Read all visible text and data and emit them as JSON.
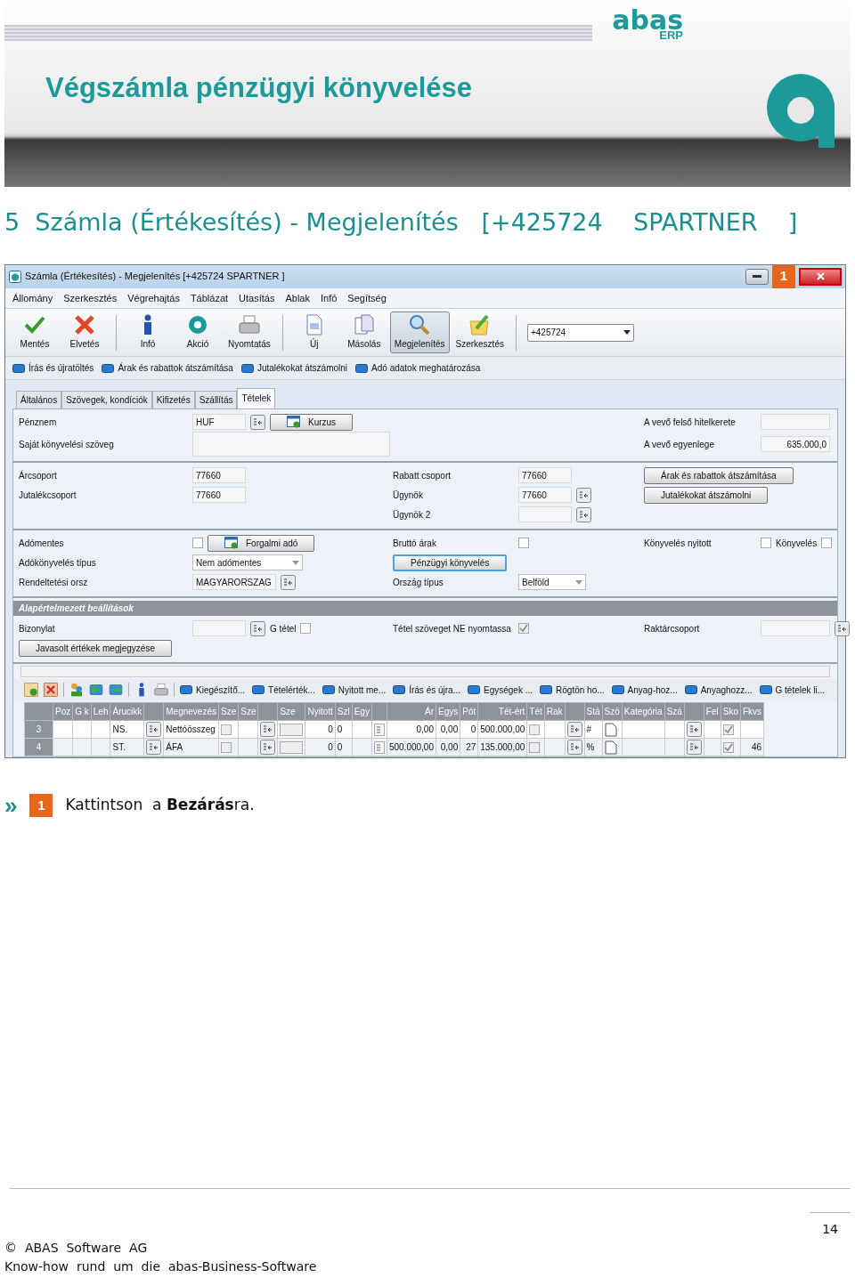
{
  "banner": {
    "logo": "abas",
    "logo_sub": "ERP",
    "title": "Végszámla pénzügyi könyvelése"
  },
  "heading": "5  Számla (Értékesítés) - Megjelenítés   [+425724    SPARTNER    ]",
  "window": {
    "title": "Számla (Értékesítés) - Megjelenítés  [+425724   SPARTNER   ]",
    "callout": "1",
    "menu": [
      "Állomány",
      "Szerkesztés",
      "Végrehajtás",
      "Táblázat",
      "Utasítás",
      "Ablak",
      "Infó",
      "Segítség"
    ],
    "toolbar": [
      {
        "kind": "save",
        "label": "Mentés",
        "selected": false
      },
      {
        "kind": "discard",
        "label": "Elvetés",
        "selected": false
      },
      {
        "kind": "sep"
      },
      {
        "kind": "info",
        "label": "Infó",
        "selected": false
      },
      {
        "kind": "action",
        "label": "Akció",
        "selected": false
      },
      {
        "kind": "print",
        "label": "Nyomtatás",
        "selected": false
      },
      {
        "kind": "sep"
      },
      {
        "kind": "new",
        "label": "Új",
        "selected": false
      },
      {
        "kind": "copy",
        "label": "Másolás",
        "selected": false
      },
      {
        "kind": "view",
        "label": "Megjelenítés",
        "selected": true
      },
      {
        "kind": "edit",
        "label": "Szerkesztés",
        "selected": false
      },
      {
        "kind": "sep"
      }
    ],
    "record_combo": {
      "value": "+425724"
    },
    "actions": [
      "Írás és újratöltés",
      "Árak és rabattok átszámítása",
      "Jutalékokat átszámolni",
      "Adó adatok meghatározása"
    ],
    "tabs": [
      {
        "label": "Általános",
        "selected": false
      },
      {
        "label": "Szövegek, kondíciók",
        "selected": false
      },
      {
        "label": "Kifizetés",
        "selected": false
      },
      {
        "label": "Szállítás",
        "selected": false
      },
      {
        "label": "Tételek",
        "selected": true
      }
    ],
    "sections": [
      {
        "rows": [
          {
            "cells": [
              [
                {
                  "kind": "label",
                  "text": "Pénznem"
                },
                {
                  "kind": "field",
                  "value": "HUF",
                  "lookup": true
                },
                {
                  "kind": "button",
                  "label": "Kurzus",
                  "icon": true
                }
              ],
              [],
              [
                {
                  "kind": "label",
                  "text": "A vevő felső hitelkerete"
                },
                {
                  "kind": "field"
                }
              ]
            ]
          },
          {
            "cells": [
              [
                {
                  "kind": "label",
                  "text": "Saját könyvelési szöveg"
                },
                {
                  "kind": "area"
                }
              ],
              [],
              [
                {
                  "kind": "label",
                  "text": "A vevő egyenlege"
                },
                {
                  "kind": "field",
                  "value": "635.000,0"
                }
              ]
            ]
          }
        ]
      },
      {
        "rows": [
          {
            "cells": [
              [
                {
                  "kind": "label",
                  "text": "Árcsoport"
                },
                {
                  "kind": "field",
                  "value": "77660"
                }
              ],
              [
                {
                  "kind": "label",
                  "text": "Rabatt csoport"
                },
                {
                  "kind": "field",
                  "value": "77660"
                }
              ],
              [
                {
                  "kind": "button",
                  "label": "Árak és rabattok átszámítása"
                }
              ]
            ]
          },
          {
            "cells": [
              [
                {
                  "kind": "label",
                  "text": "Jutalékcsoport"
                },
                {
                  "kind": "field",
                  "value": "77660"
                }
              ],
              [
                {
                  "kind": "label",
                  "text": "Ügynök"
                },
                {
                  "kind": "field",
                  "value": "77660",
                  "lookup": true
                }
              ],
              [
                {
                  "kind": "button",
                  "label": "Jutalékokat átszámolni"
                }
              ]
            ]
          },
          {
            "cells": [
              [],
              [
                {
                  "kind": "label",
                  "text": "Ügynök 2"
                },
                {
                  "kind": "field",
                  "lookup": true
                }
              ],
              []
            ]
          }
        ]
      },
      {
        "rows": [
          {
            "cells": [
              [
                {
                  "kind": "label",
                  "text": "Adómentes"
                },
                {
                  "kind": "checkbox",
                  "checked": false
                },
                {
                  "kind": "button",
                  "label": "Forgalmi adó",
                  "icon": true
                }
              ],
              [
                {
                  "kind": "label",
                  "text": "Bruttó árak"
                },
                {
                  "kind": "checkbox",
                  "checked": false
                }
              ],
              [
                {
                  "kind": "label",
                  "text": "Könyvelés nyitott"
                },
                {
                  "kind": "checkbox",
                  "checked": false
                },
                {
                  "kind": "label",
                  "text": "Könyvelés"
                },
                {
                  "kind": "checkbox",
                  "checked": false
                }
              ]
            ]
          },
          {
            "cells": [
              [
                {
                  "kind": "label",
                  "text": "Adókönyvelés típus"
                },
                {
                  "kind": "select",
                  "value": "Nem adómentes"
                }
              ],
              [
                {
                  "kind": "button",
                  "label": "Pénzügyi könyvelés",
                  "focused": true
                }
              ],
              []
            ]
          },
          {
            "cells": [
              [
                {
                  "kind": "label",
                  "text": "Rendeltetési orsz"
                },
                {
                  "kind": "field",
                  "value": "MAGYARORSZAG",
                  "lookup": true
                }
              ],
              [
                {
                  "kind": "label",
                  "text": "Ország típus"
                },
                {
                  "kind": "select",
                  "value": "Belföld"
                }
              ],
              []
            ]
          }
        ]
      },
      {
        "header": "Alapértelmezett beállítások",
        "rows": [
          {
            "cells": [
              [
                {
                  "kind": "label",
                  "text": "Bizonylat"
                },
                {
                  "kind": "field",
                  "lookup": true
                },
                {
                  "kind": "label",
                  "text": "G tétel"
                },
                {
                  "kind": "checkbox",
                  "checked": false
                }
              ],
              [
                {
                  "kind": "label",
                  "text": "Tétel szöveget NE nyomtassa"
                },
                {
                  "kind": "checkbox",
                  "checked": true,
                  "disabled": true
                }
              ],
              [
                {
                  "kind": "label",
                  "text": "Raktárcsoport"
                },
                {
                  "kind": "field",
                  "lookup": true
                }
              ]
            ]
          },
          {
            "cells": [
              [
                {
                  "kind": "button",
                  "label": "Javasolt értékek megjegyzése"
                }
              ],
              [],
              []
            ]
          }
        ]
      }
    ],
    "grid_toolbar": [
      {
        "kind": "grid-add"
      },
      {
        "kind": "grid-delete"
      },
      {
        "kind": "sep"
      },
      {
        "kind": "people"
      },
      {
        "kind": "arrow-left"
      },
      {
        "kind": "arrow-right"
      },
      {
        "kind": "sep"
      },
      {
        "kind": "info"
      },
      {
        "kind": "print"
      },
      {
        "kind": "sep"
      }
    ],
    "grid_actions": [
      "Kiegészítő...",
      "Tételérték...",
      "Nyitott me...",
      "Írás és újra...",
      "Egységek ...",
      "Rögtön ho...",
      "Anyag-hoz...",
      "Anyaghozz...",
      "G tételek li..."
    ],
    "grid": {
      "columns": [
        "Poz",
        "G k",
        "Leh",
        "Árucikk",
        "Megnevezés",
        "Sze",
        "Sze",
        "Sze",
        "Nyitott",
        "Szl",
        "Egy",
        "Ár",
        "Egys",
        "Pót",
        "Tét-ért",
        "Tét",
        "Rak",
        "Stá",
        "Szö",
        "Kategória",
        "Szá",
        "Fel",
        "Sko",
        "Fkvs"
      ],
      "rows": [
        {
          "number": "3",
          "article": "NS.",
          "name": "Nettóösszeg",
          "sze_check": false,
          "open": "0",
          "szl": "0",
          "price": "0,00",
          "unit": "0,00",
          "surcharge": "0",
          "total": "500.000,00",
          "tet_check": false,
          "status": "#",
          "skonto": true
        },
        {
          "number": "4",
          "article": "ST.",
          "name": "ÁFA",
          "sze_check": false,
          "open": "0",
          "szl": "0",
          "price": "500.000,00",
          "unit": "0,00",
          "surcharge": "27",
          "total": "135.000,00",
          "tet_check": false,
          "status": "%",
          "skonto": true,
          "fkvs": "46"
        }
      ]
    }
  },
  "instruction": {
    "marker": "»",
    "callout": "1",
    "text": "Kattintson  a **Bezárás**ra."
  },
  "footer": {
    "page": "14",
    "copyright": "©  ABAS  Software  AG",
    "tagline": "Know-how  rund  um  die  abas-Business-Software"
  }
}
